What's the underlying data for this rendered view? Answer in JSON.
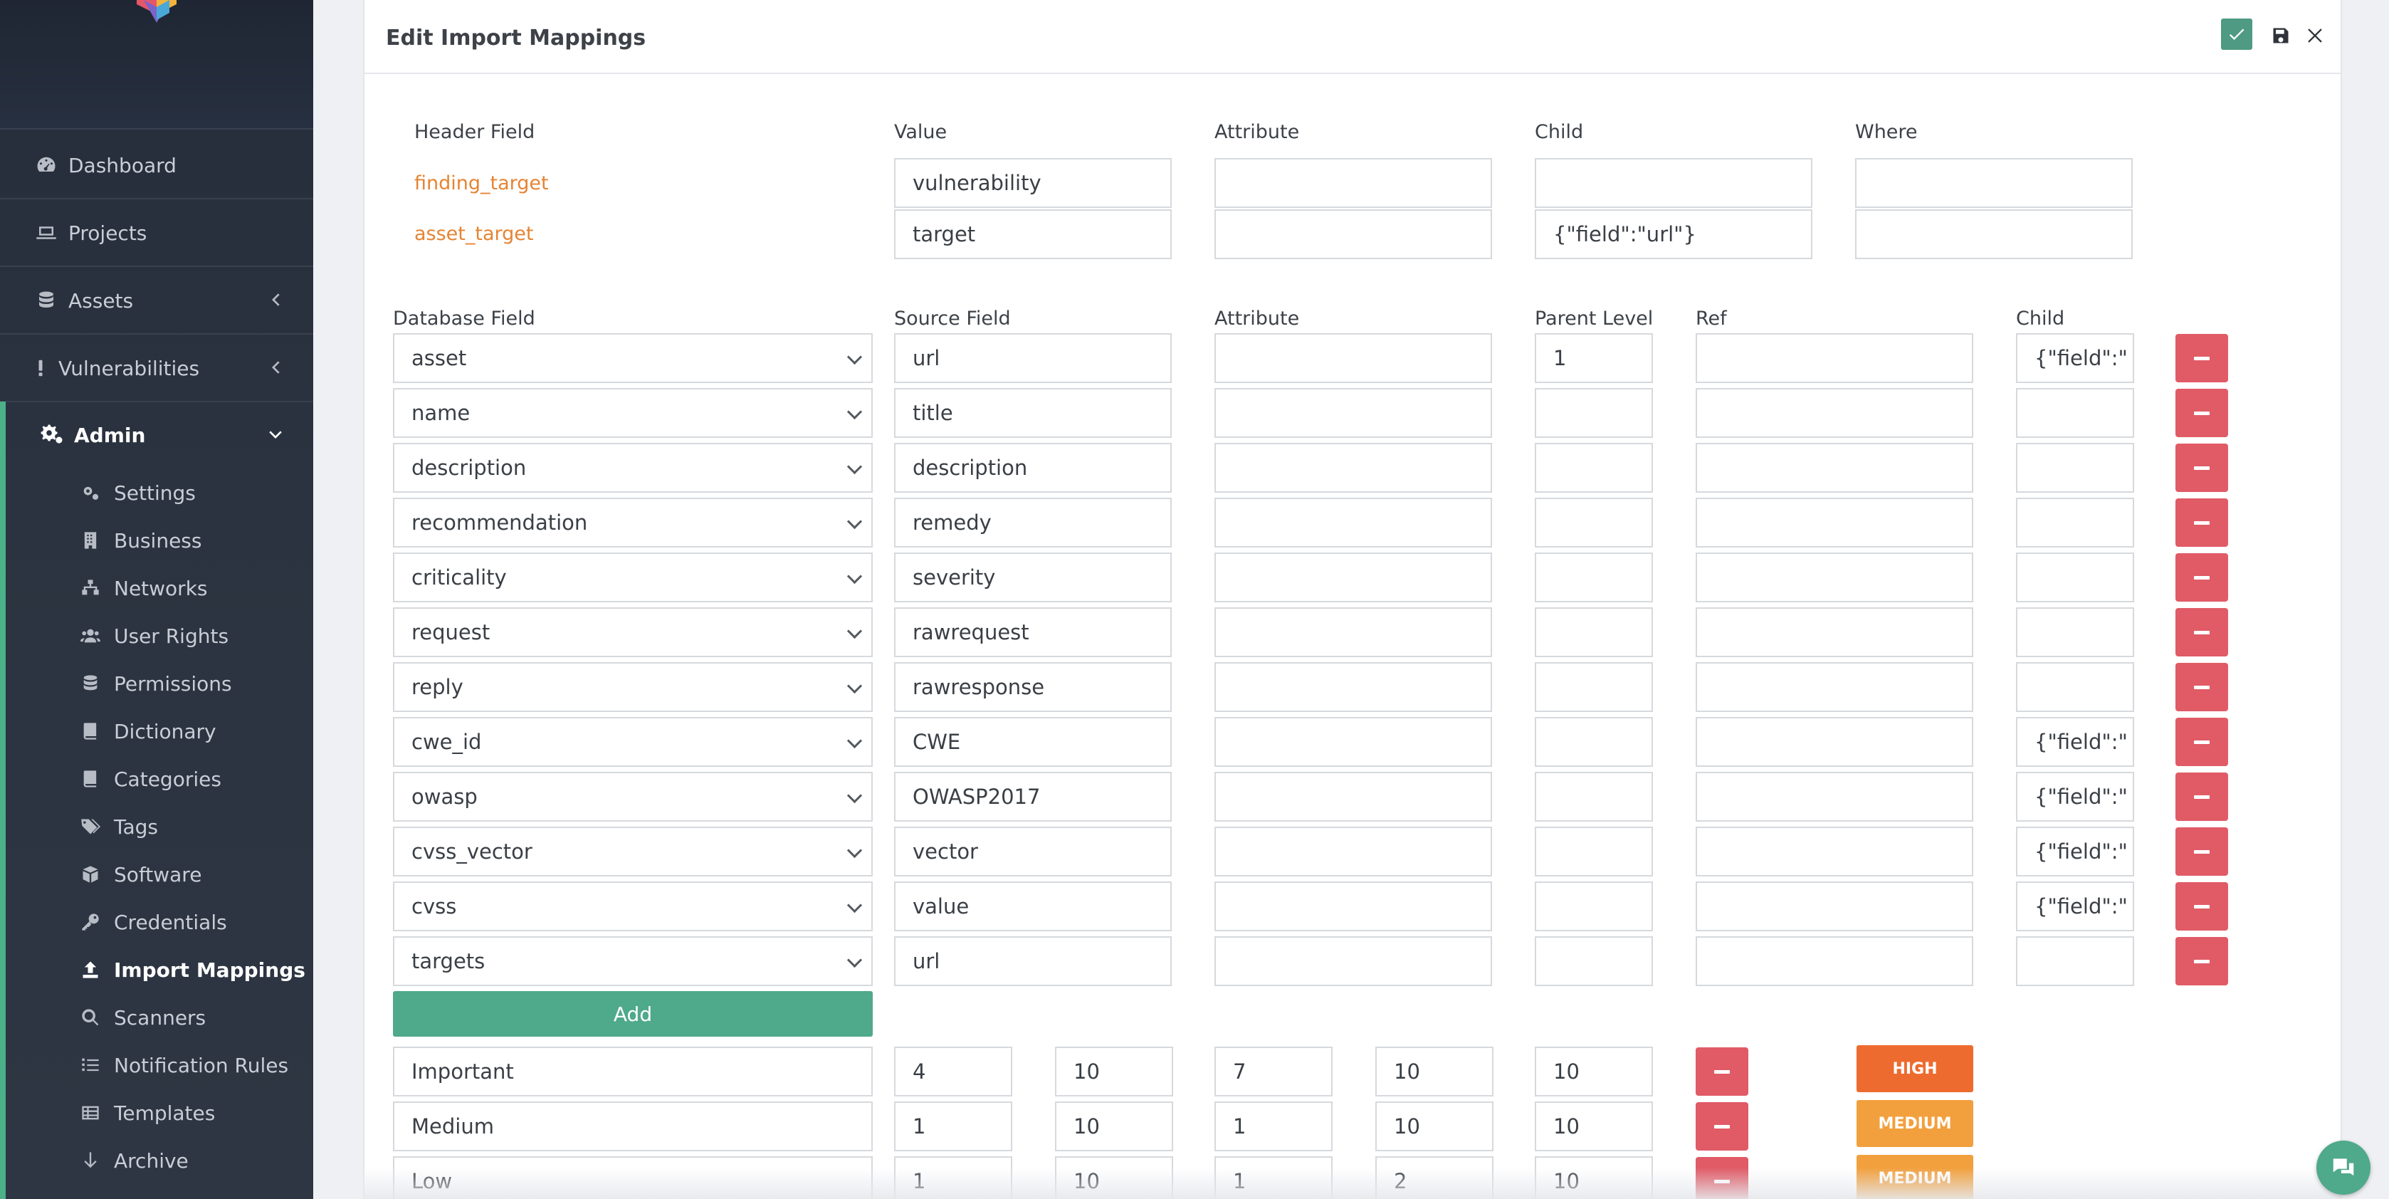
{
  "sidebar": {
    "nav": [
      {
        "label": "Dashboard",
        "icon": "gauge-icon"
      },
      {
        "label": "Projects",
        "icon": "laptop-icon"
      },
      {
        "label": "Assets",
        "icon": "database-icon"
      },
      {
        "label": "Vulnerabilities",
        "icon": "exclamation-icon"
      }
    ],
    "admin": {
      "label": "Admin",
      "icon": "cogs-icon",
      "items": [
        {
          "label": "Settings",
          "icon": "cogs-icon"
        },
        {
          "label": "Business",
          "icon": "building-icon"
        },
        {
          "label": "Networks",
          "icon": "sitemap-icon"
        },
        {
          "label": "User Rights",
          "icon": "users-icon"
        },
        {
          "label": "Permissions",
          "icon": "database-icon"
        },
        {
          "label": "Dictionary",
          "icon": "book-icon"
        },
        {
          "label": "Categories",
          "icon": "book-icon"
        },
        {
          "label": "Tags",
          "icon": "tags-icon"
        },
        {
          "label": "Software",
          "icon": "boxes-icon"
        },
        {
          "label": "Credentials",
          "icon": "key-icon"
        },
        {
          "label": "Import Mappings",
          "icon": "upload-icon",
          "active": true
        },
        {
          "label": "Scanners",
          "icon": "search-icon"
        },
        {
          "label": "Notification Rules",
          "icon": "list-icon"
        },
        {
          "label": "Templates",
          "icon": "table-icon"
        },
        {
          "label": "Archive",
          "icon": "arrow-down-icon"
        }
      ]
    }
  },
  "panel": {
    "title": "Edit Import Mappings",
    "header_table": {
      "columns": [
        "Header Field",
        "Value",
        "Attribute",
        "Child",
        "Where"
      ],
      "rows": [
        {
          "key": "finding_target",
          "value": "vulnerability",
          "attribute": "",
          "child": "",
          "where": ""
        },
        {
          "key": "asset_target",
          "value": "target",
          "attribute": "",
          "child": "{\"field\":\"url\"}",
          "where": ""
        }
      ]
    },
    "db_table": {
      "columns": [
        "Database Field",
        "Source Field",
        "Attribute",
        "Parent Level",
        "Ref",
        "Child"
      ],
      "rows": [
        {
          "db": "asset",
          "source": "url",
          "attribute": "",
          "parent": "1",
          "ref": "",
          "child": "{\"field\":\""
        },
        {
          "db": "name",
          "source": "title",
          "attribute": "",
          "parent": "",
          "ref": "",
          "child": ""
        },
        {
          "db": "description",
          "source": "description",
          "attribute": "",
          "parent": "",
          "ref": "",
          "child": ""
        },
        {
          "db": "recommendation",
          "source": "remedy",
          "attribute": "",
          "parent": "",
          "ref": "",
          "child": ""
        },
        {
          "db": "criticality",
          "source": "severity",
          "attribute": "",
          "parent": "",
          "ref": "",
          "child": ""
        },
        {
          "db": "request",
          "source": "rawrequest",
          "attribute": "",
          "parent": "",
          "ref": "",
          "child": ""
        },
        {
          "db": "reply",
          "source": "rawresponse",
          "attribute": "",
          "parent": "",
          "ref": "",
          "child": ""
        },
        {
          "db": "cwe_id",
          "source": "CWE",
          "attribute": "",
          "parent": "",
          "ref": "",
          "child": "{\"field\":\""
        },
        {
          "db": "owasp",
          "source": "OWASP2017",
          "attribute": "",
          "parent": "",
          "ref": "",
          "child": "{\"field\":\""
        },
        {
          "db": "cvss_vector",
          "source": "vector",
          "attribute": "",
          "parent": "",
          "ref": "",
          "child": "{\"field\":\""
        },
        {
          "db": "cvss",
          "source": "value",
          "attribute": "",
          "parent": "",
          "ref": "",
          "child": "{\"field\":\""
        },
        {
          "db": "targets",
          "source": "url",
          "attribute": "",
          "parent": "",
          "ref": "",
          "child": ""
        }
      ],
      "add_label": "Add"
    },
    "severity_table": {
      "rows": [
        {
          "name": "Important",
          "v1": "4",
          "v2": "10",
          "v3": "7",
          "v4": "10",
          "v5": "10",
          "badge": "HIGH",
          "badge_color": "#ee6b2f"
        },
        {
          "name": "Medium",
          "v1": "1",
          "v2": "10",
          "v3": "1",
          "v4": "10",
          "v5": "10",
          "badge": "MEDIUM",
          "badge_color": "#f2a03d"
        },
        {
          "name": "Low",
          "v1": "1",
          "v2": "10",
          "v3": "1",
          "v4": "2",
          "v5": "10",
          "badge": "MEDIUM",
          "badge_color": "#f2a03d"
        }
      ]
    }
  },
  "colors": {
    "accent": "#4fa98b",
    "danger": "#e05b66",
    "key_text": "#e68433",
    "sidebar_bg": "#2b3340"
  }
}
